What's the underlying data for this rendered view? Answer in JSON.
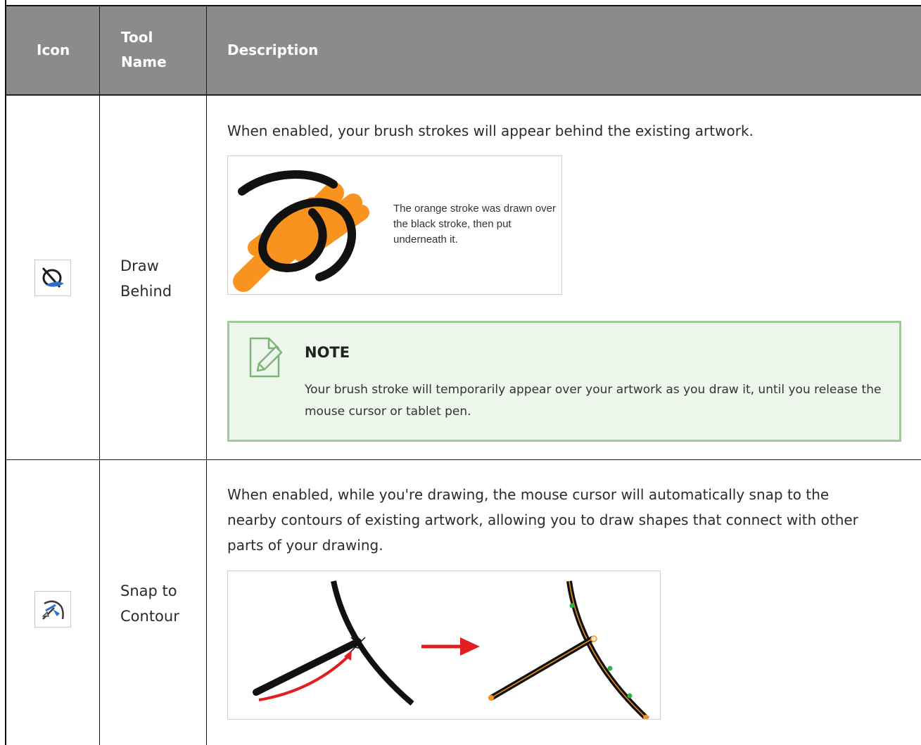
{
  "header": {
    "icon": "Icon",
    "tool_name_line1": "Tool",
    "tool_name_line2": "Name",
    "description": "Description",
    "background": "#8a8b8d"
  },
  "rows": [
    {
      "icon": "draw-behind-icon",
      "name_line1": "Draw",
      "name_line2": "Behind",
      "description": "When enabled, your brush strokes will appear behind the existing artwork.",
      "figure_caption": "The orange stroke was drawn over the black stroke, then put underneath it.",
      "note": {
        "title": "NOTE",
        "body": "Your brush stroke will temporarily appear over your artwork as you draw it, until you release the mouse cursor or tablet pen."
      }
    },
    {
      "icon": "snap-to-contour-icon",
      "name_line1": "Snap to",
      "name_line2": "Contour",
      "description_lines": [
        "When enabled, while you're drawing, the mouse cursor will automatically snap to the",
        "nearby contours of existing artwork, allowing you to draw shapes that connect with other",
        "parts of your drawing."
      ]
    }
  ],
  "colors": {
    "orange_stroke": "#f7931e",
    "note_bg": "#eef7ec",
    "note_border": "#9fcb9a",
    "arrow_red": "#e02020"
  }
}
